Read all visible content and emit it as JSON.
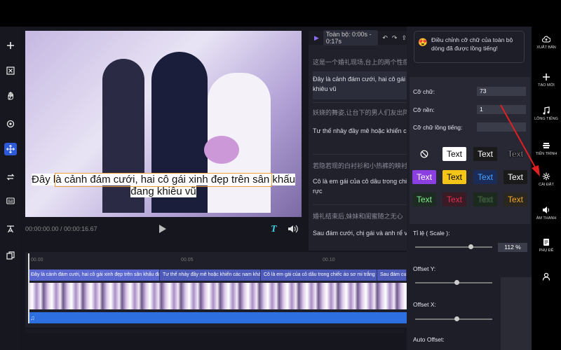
{
  "preview": {
    "caption_text": "Đây là cảnh đám cưới, hai cô gái xinh đẹp trên sân khấu đang khiêu vũ",
    "time_display": "00:00:00.00 / 00:00:16.67"
  },
  "script_panel": {
    "header_range": "Toàn bộ: 0:00s - 0:17s",
    "segments": [
      {
        "zh": "这是一个婚礼现场,台上的两个性感",
        "vi": "Đây là cảnh đám cưới, hai cô gái x",
        "vi2": "khiêu vũ"
      },
      {
        "zh": "妖娆的舞姿,让台下的男人们友出阵",
        "vi": "Tư thế nhảy đầy mê hoặc khiến cá",
        "vi2": ""
      },
      {
        "zh": "若隐若现的白衬衫和小热裤的映衬",
        "vi": "Cô là em gái của cô dâu trong chiế",
        "vi2": "rực"
      },
      {
        "zh": "婚礼结束后,妹妹和闺蜜随之无心",
        "vi": "Sau đám cưới, chị gái và anh rể vu",
        "vi2": ""
      }
    ]
  },
  "timeline": {
    "ruler_labels": [
      "00.00",
      "00.05",
      "00.10"
    ],
    "subtitle_clips": [
      "Đây là cảnh đám cưới, hai cô gái xinh đẹp trên sân khấu đang k",
      "Tư thế nhảy đầy mê hoặc khiến các nam khán g",
      "Cô là em gái của cô dâu trong chiếc áo sơ mi trắng và c",
      "Sau đám cư"
    ],
    "audio_icon": "♫"
  },
  "settings": {
    "tip_emoji": "😍",
    "tip_text": "Điều chỉnh cỡ chữ của toàn bộ dòng đã được lồng tiếng!",
    "font_size_label": "Cỡ chữ:",
    "font_size_value": "73",
    "bg_label": "Cỡ nền:",
    "bg_value": "1",
    "dub_font_label": "Cỡ chữ lồng tiếng:",
    "dub_font_value": "",
    "style_sample": "Text",
    "scale_label": "Tỉ lệ ( Scale ):",
    "scale_value": "112 %",
    "offset_y_label": "Offset Y:",
    "offset_x_label": "Offset X:",
    "auto_offset_label": "Auto Offset:"
  },
  "right_rail": {
    "export": "Xuất bản",
    "new": "Tạo mới",
    "dub": "Lồng tiếng",
    "progress": "Tiến trình",
    "settings": "Cài đặt",
    "audio": "Âm thanh",
    "subtitle": "Phụ đề",
    "account": ""
  },
  "colors": {
    "accent_blue": "#2d5bd8",
    "subtitle_track": "#4d5ab8",
    "audio_track": "#2e6fe0",
    "highlight_box": "#f0a13a",
    "arrow": "#e02020"
  }
}
